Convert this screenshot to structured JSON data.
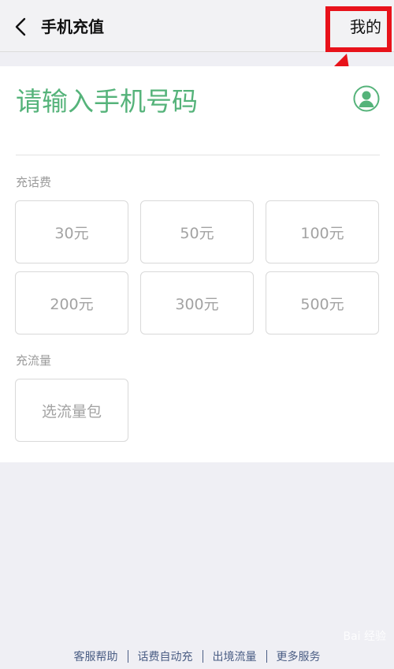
{
  "header": {
    "title": "手机充值",
    "mine_label": "我的"
  },
  "phone": {
    "placeholder": "请输入手机号码"
  },
  "sections": {
    "call_fee_label": "充话费",
    "data_label": "充流量"
  },
  "amounts": [
    "30元",
    "50元",
    "100元",
    "200元",
    "300元",
    "500元"
  ],
  "data_pack_label": "选流量包",
  "footer": {
    "links": [
      "客服帮助",
      "话费自动充",
      "出境流量",
      "更多服务"
    ]
  },
  "watermark": "Bai 经验",
  "colors": {
    "accent_green": "#55b37a",
    "highlight_red": "#e8121a",
    "footer_link": "#4a5d84"
  },
  "icons": {
    "back": "chevron-left-icon",
    "contact": "person-circle-icon"
  }
}
